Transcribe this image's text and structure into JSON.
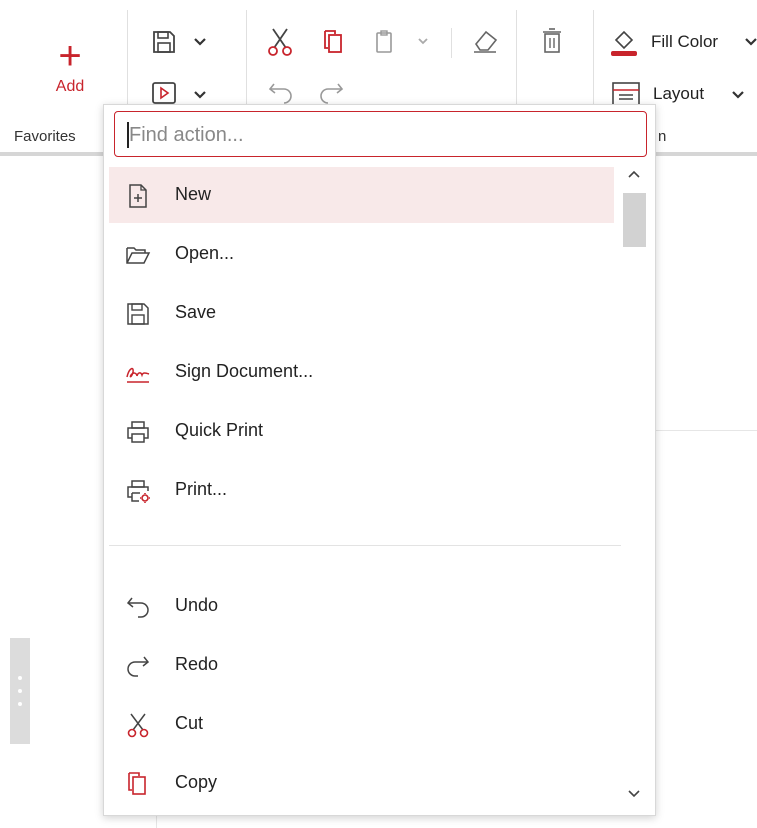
{
  "ribbon": {
    "add_label": "Add",
    "favorites_label": "Favorites",
    "fill_color_label": "Fill Color",
    "layout_label": "Layout",
    "partial_group_label": "n"
  },
  "dropdown": {
    "search_placeholder": "Find action...",
    "items_top": [
      {
        "label": "New",
        "icon": "new-file-icon"
      },
      {
        "label": "Open...",
        "icon": "folder-open-icon"
      },
      {
        "label": "Save",
        "icon": "save-icon"
      },
      {
        "label": "Sign Document...",
        "icon": "signature-icon"
      },
      {
        "label": "Quick Print",
        "icon": "printer-icon"
      },
      {
        "label": "Print...",
        "icon": "print-settings-icon"
      }
    ],
    "items_bottom": [
      {
        "label": "Undo",
        "icon": "undo-icon"
      },
      {
        "label": "Redo",
        "icon": "redo-icon"
      },
      {
        "label": "Cut",
        "icon": "scissors-icon"
      },
      {
        "label": "Copy",
        "icon": "copy-icon"
      }
    ]
  },
  "colors": {
    "accent": "#c8242c",
    "highlight": "#f8e9e9"
  }
}
